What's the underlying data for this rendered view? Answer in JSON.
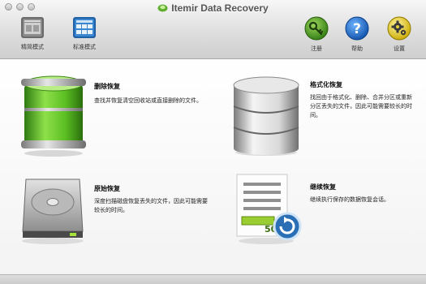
{
  "app": {
    "title": "Itemir Data Recovery"
  },
  "toolbar": {
    "simple_mode": "精简模式",
    "standard_mode": "标准模式",
    "register": "注册",
    "help": "帮助",
    "settings": "设置"
  },
  "options": [
    {
      "title": "删除恢复",
      "desc": "查找并恢复清空回收站或直接删除的文件。"
    },
    {
      "title": "格式化恢复",
      "desc": "找回由于格式化、删除、合并分区或重新分区丢失的文件，因此可能需要较长的时间。"
    },
    {
      "title": "原始恢复",
      "desc": "深度扫描磁盘恢复丢失的文件，因此可能需要较长的时间。"
    },
    {
      "title": "继续恢复",
      "desc": "继续执行保存的数据恢复会话。"
    }
  ],
  "icons": {
    "badge_text": "50",
    "accent": "#2a6fb5"
  }
}
